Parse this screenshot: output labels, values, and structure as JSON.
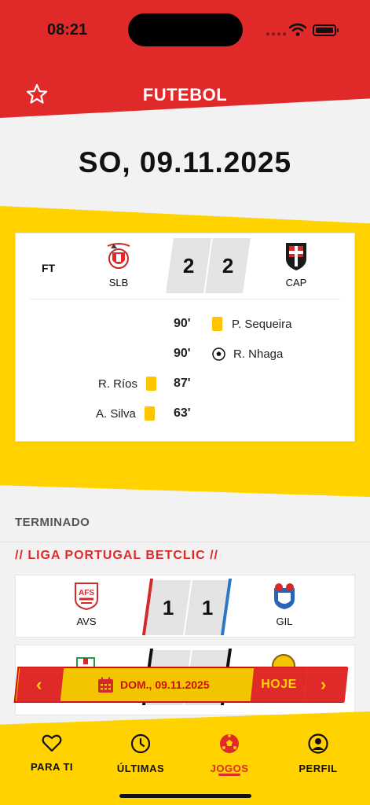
{
  "status_bar": {
    "time": "08:21"
  },
  "header": {
    "title": "FUTEBOL"
  },
  "date_heading": "SO, 09.11.2025",
  "featured_match": {
    "status": "FT",
    "home": {
      "abbr": "SLB",
      "score": "2"
    },
    "away": {
      "abbr": "CAP",
      "score": "2"
    },
    "events": [
      {
        "side": "away",
        "minute": "90'",
        "type": "yellow-card",
        "player": "P. Sequeira"
      },
      {
        "side": "away",
        "minute": "90'",
        "type": "goal",
        "player": "R. Nhaga"
      },
      {
        "side": "home",
        "minute": "87'",
        "type": "yellow-card",
        "player": "R. Ríos"
      },
      {
        "side": "home",
        "minute": "63'",
        "type": "yellow-card",
        "player": "A. Silva"
      }
    ]
  },
  "section_label": "TERMINADO",
  "league_title": "// LIGA PORTUGAL BETCLIC //",
  "matches": [
    {
      "home": "AVS",
      "away": "GIL",
      "home_score": "1",
      "away_score": "1"
    }
  ],
  "date_picker": {
    "date": "DOM., 09.11.2025",
    "today_label": "HOJE"
  },
  "bottom_nav": [
    {
      "label": "PARA TI",
      "icon": "heart-icon",
      "active": false
    },
    {
      "label": "ÚLTIMAS",
      "icon": "clock-icon",
      "active": false
    },
    {
      "label": "JOGOS",
      "icon": "football-icon",
      "active": true
    },
    {
      "label": "PERFIL",
      "icon": "profile-icon",
      "active": false
    }
  ],
  "colors": {
    "brand_red": "#e02a2a",
    "brand_yellow": "#ffd200",
    "card_yellow": "#ffc400"
  }
}
